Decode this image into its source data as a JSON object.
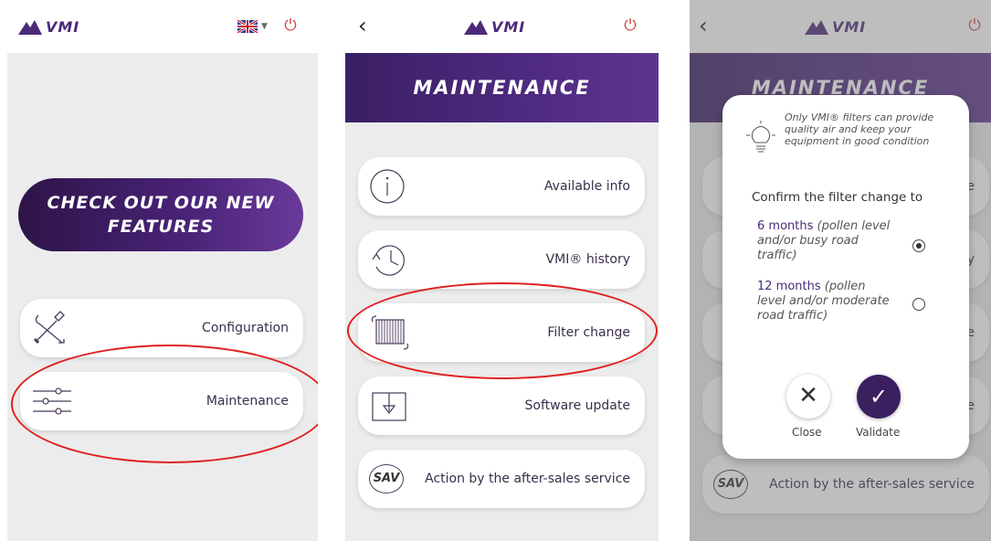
{
  "brand": {
    "logo_text": "VMI",
    "accent": "#4b2a78",
    "power_color": "#d23a3a"
  },
  "screen1": {
    "language_flag": "uk-flag-icon",
    "promo_label": "CHECK OUT OUR NEW FEATURES",
    "menu": [
      {
        "label": "Configuration",
        "icon": "tools-icon"
      },
      {
        "label": "Maintenance",
        "icon": "sliders-icon"
      }
    ]
  },
  "screen2": {
    "title": "MAINTENANCE",
    "menu": [
      {
        "label": "Available info",
        "icon": "info-icon"
      },
      {
        "label": "VMI® history",
        "icon": "history-icon"
      },
      {
        "label": "Filter change",
        "icon": "filter-icon"
      },
      {
        "label": "Software update",
        "icon": "download-icon"
      },
      {
        "label": "Action by the after-sales service",
        "icon": "sav-icon",
        "icon_text": "SAV"
      }
    ]
  },
  "screen3": {
    "title": "MAINTENANCE",
    "bg_visible": [
      {
        "label": "e"
      },
      {
        "label": "y"
      },
      {
        "label": "e"
      },
      {
        "label": "e"
      },
      {
        "label": "Action by the after-sales service"
      }
    ],
    "dialog": {
      "tip": "Only VMI® filters can provide quality air and keep your equipment in good condition",
      "confirm_label": "Confirm the filter change to",
      "options": [
        {
          "bold": "6 months",
          "rest": " (pollen level and/or busy road traffic)",
          "selected": true
        },
        {
          "bold": "12 months",
          "rest": " (pollen level and/or moderate road traffic)",
          "selected": false
        }
      ],
      "close_label": "Close",
      "validate_label": "Validate"
    }
  }
}
